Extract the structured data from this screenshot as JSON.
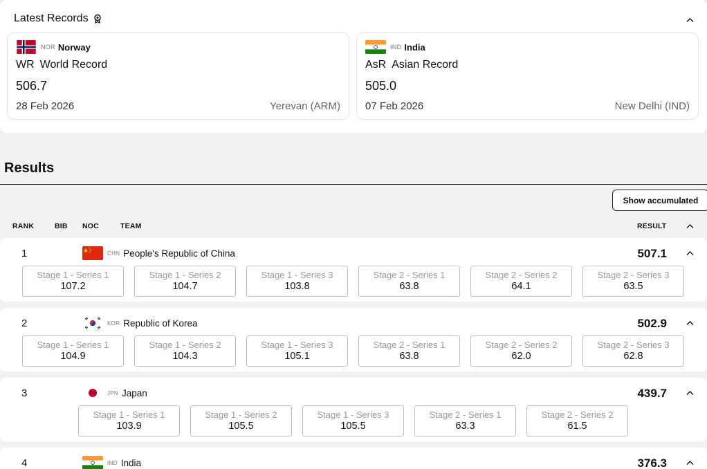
{
  "records": {
    "title": "Latest Records",
    "items": [
      {
        "code": "NOR",
        "country": "Norway",
        "abbr": "WR",
        "type": "World Record",
        "value": "506.7",
        "date": "28 Feb 2026",
        "place": "Yerevan (ARM)"
      },
      {
        "code": "IND",
        "country": "India",
        "abbr": "AsR",
        "type": "Asian Record",
        "value": "505.0",
        "date": "07 Feb 2026",
        "place": "New Delhi (IND)"
      }
    ]
  },
  "results": {
    "title": "Results",
    "show_accumulated": "Show accumulated",
    "columns": {
      "rank": "RANK",
      "bib": "BIB",
      "noc": "NOC",
      "team": "TEAM",
      "result": "RESULT"
    },
    "teams": [
      {
        "rank": "1",
        "code": "CHN",
        "name": "People's Republic of China",
        "result": "507.1",
        "series": [
          {
            "label": "Stage 1 - Series 1",
            "value": "107.2"
          },
          {
            "label": "Stage 1 - Series 2",
            "value": "104.7"
          },
          {
            "label": "Stage 1 - Series 3",
            "value": "103.8"
          },
          {
            "label": "Stage 2 - Series 1",
            "value": "63.8"
          },
          {
            "label": "Stage 2 - Series 2",
            "value": "64.1"
          },
          {
            "label": "Stage 2 - Series 3",
            "value": "63.5"
          }
        ]
      },
      {
        "rank": "2",
        "code": "KOR",
        "name": "Republic of Korea",
        "result": "502.9",
        "series": [
          {
            "label": "Stage 1 - Series 1",
            "value": "104.9"
          },
          {
            "label": "Stage 1 - Series 2",
            "value": "104.3"
          },
          {
            "label": "Stage 1 - Series 3",
            "value": "105.1"
          },
          {
            "label": "Stage 2 - Series 1",
            "value": "63.8"
          },
          {
            "label": "Stage 2 - Series 2",
            "value": "62.0"
          },
          {
            "label": "Stage 2 - Series 3",
            "value": "62.8"
          }
        ]
      },
      {
        "rank": "3",
        "code": "JPN",
        "name": "Japan",
        "result": "439.7",
        "series": [
          {
            "label": "Stage 1 - Series 1",
            "value": "103.9"
          },
          {
            "label": "Stage 1 - Series 2",
            "value": "105.5"
          },
          {
            "label": "Stage 1 - Series 3",
            "value": "105.5"
          },
          {
            "label": "Stage 2 - Series 1",
            "value": "63.3"
          },
          {
            "label": "Stage 2 - Series 2",
            "value": "61.5"
          }
        ]
      },
      {
        "rank": "4",
        "code": "IND",
        "name": "India",
        "result": "376.3",
        "series": []
      }
    ]
  }
}
